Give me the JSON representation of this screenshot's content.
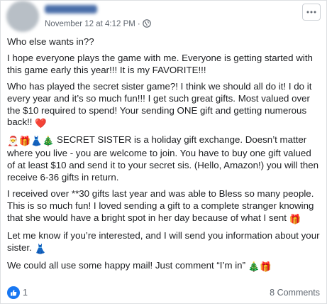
{
  "post": {
    "timestamp": "November 12 at 4:12 PM",
    "separator": "·",
    "paragraphs": {
      "p1": "Who else wants in??",
      "p2": "I hope everyone plays the game with me. Everyone is getting started with this game early this year!!! It is my FAVORITE!!!",
      "p3": "Who has played the secret sister game?! I think we should all do it! I do it every year and it’s so much fun!!! I get such great gifts. Most valued over the $10 required to spend! Your sending ONE gift and getting numerous back!!",
      "p4": "SECRET SISTER is a holiday gift exchange. Doesn’t matter where you live - you are welcome to join. You have to buy one gift valued of at least $10 and send it to your secret sis. (Hello, Amazon!) you will then receive 6-36 gifts in return.",
      "p5": "I received over **30 gifts last year and was able to Bless so many people. This is so much fun! I loved sending a gift to a complete stranger knowing that she would have a bright spot in her day because of what I sent",
      "p6": "Let me know if you’re interested, and I will send you information about your sister.",
      "p7": "We could all use some happy mail! Just comment “I’m in”"
    },
    "emojis": {
      "heart": "❤️",
      "santa": "🎅",
      "gift": "🎁",
      "dress": "👗",
      "tree": "🎄"
    }
  },
  "footer": {
    "like_count": "1",
    "comments": "8 Comments"
  },
  "colors": {
    "like_blue": "#1877f2",
    "meta_gray": "#606770",
    "text": "#1c1e21"
  },
  "icons": [
    "globe-icon",
    "more-options-icon",
    "like-icon"
  ]
}
